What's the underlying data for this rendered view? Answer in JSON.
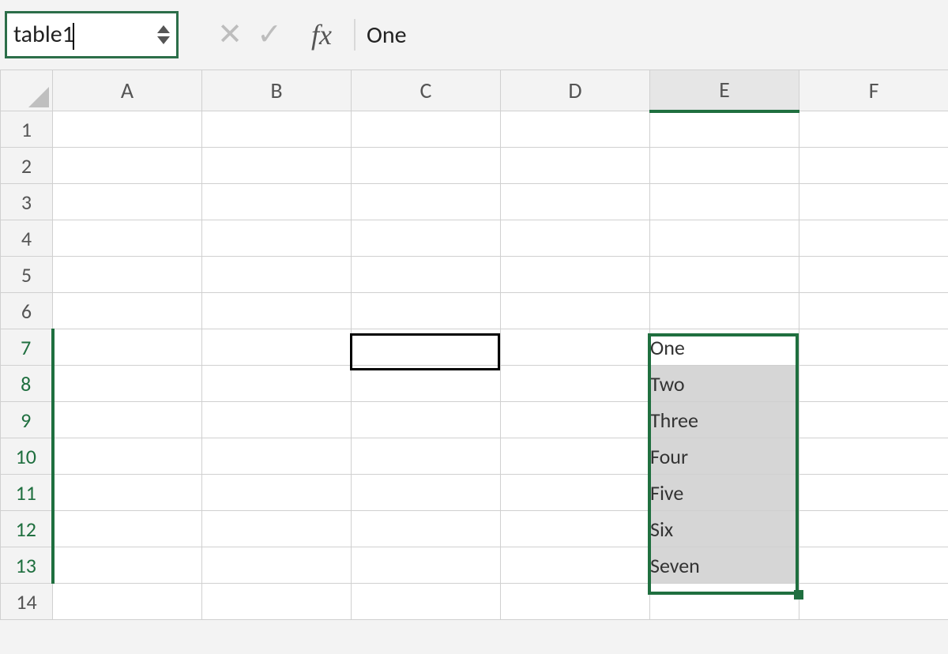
{
  "name_box": {
    "value": "table1"
  },
  "formula_bar": {
    "cancel_glyph": "✕",
    "enter_glyph": "✓",
    "fx_label": "fx",
    "value": "One"
  },
  "columns": [
    "A",
    "B",
    "C",
    "D",
    "E",
    "F"
  ],
  "rows": [
    "1",
    "2",
    "3",
    "4",
    "5",
    "6",
    "7",
    "8",
    "9",
    "10",
    "11",
    "12",
    "13",
    "14"
  ],
  "selected_column": "E",
  "selected_rows": [
    "7",
    "8",
    "9",
    "10",
    "11",
    "12",
    "13"
  ],
  "active_cell": {
    "col": "C",
    "row": "7"
  },
  "range_data": {
    "E7": "One",
    "E8": "Two",
    "E9": "Three",
    "E10": "Four",
    "E11": "Five",
    "E12": "Six",
    "E13": "Seven"
  }
}
